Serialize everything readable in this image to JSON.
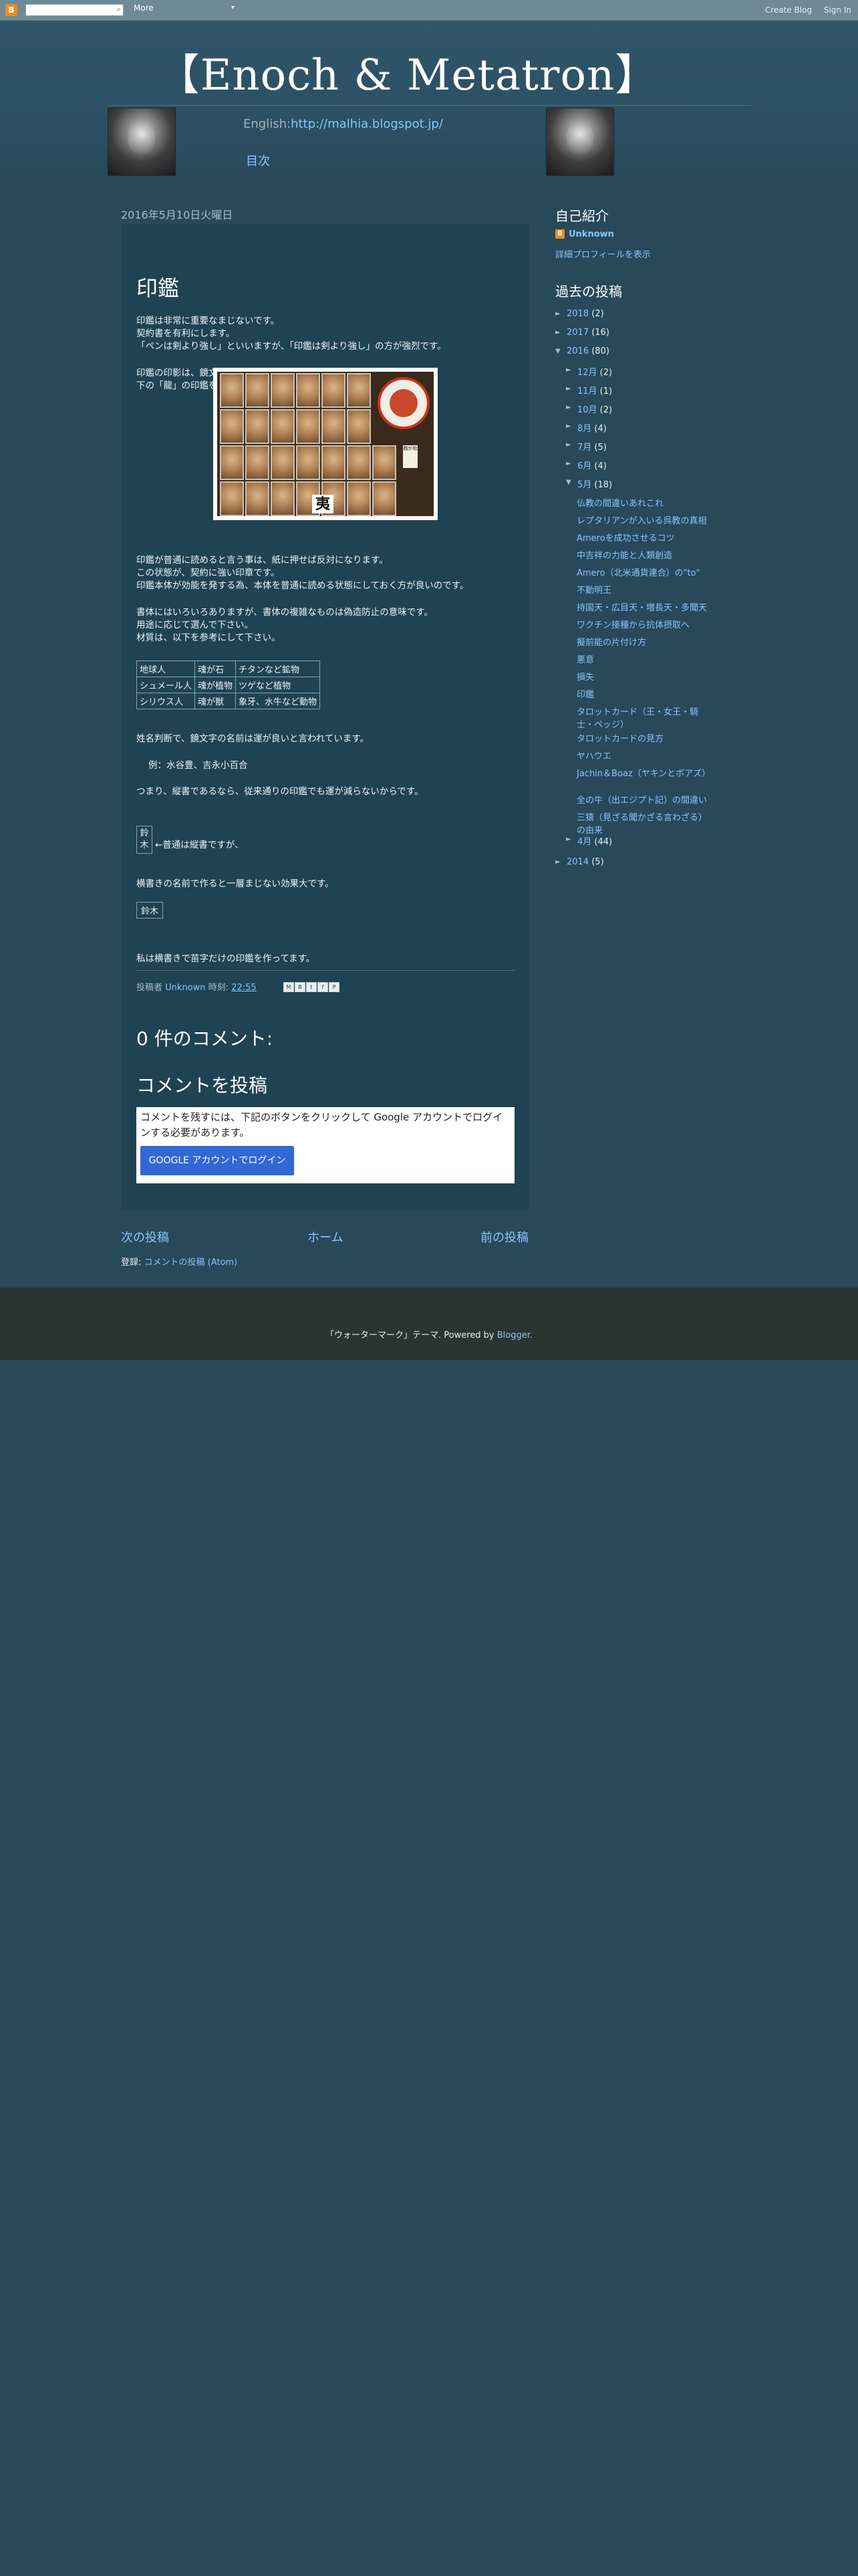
{
  "navbar": {
    "logo": "B",
    "more_label": "More",
    "create_blog": "Create Blog",
    "sign_in": "Sign In"
  },
  "header": {
    "title": "【Enoch & Metatron】",
    "english_label": "English:",
    "english_url": "http://malhia.blogspot.jp/",
    "toc_label": "目次"
  },
  "post": {
    "date": "2016年5月10日火曜日",
    "title": "印鑑",
    "paragraphs": [
      "印鑑は非常に重要なまじないです。",
      "契約書を有利にします。",
      "「ペンは剣より強し」といいますが、「印鑑は剣より強し」の方が強烈です。",
      "印鑑の印影は、鏡文字を使います。",
      "下の「龍」の印鑑を見て下さい。",
      "印鑑が普通に読めると言う事は、紙に押せば反対になります。",
      "この状態が、契約に強い印章です。",
      "印鑑本体が効能を発する為、本体を普通に読める状態にしておく方が良いのです。",
      "書体にはいろいろありますが、書体の複雑なものは偽造防止の意味です。",
      "用途に応じて選んで下さい。",
      "材質は、以下を参考にして下さい。",
      "姓名判断で、鏡文字の名前は運が良いと言われています。",
      "例：水谷豊、吉永小百合",
      "つまり、縦書であるなら、従来通りの印鑑でも運が減らないからです。",
      "←普通は縦書ですが、",
      "横書きの名前で作ると一層まじない効果大です。",
      "私は横書きで苗字だけの印鑑を作ってます。"
    ],
    "image": {
      "char": "夷",
      "tag": "鶴が和"
    },
    "materials": [
      [
        "地球人",
        "魂が石",
        "チタンなど鉱物"
      ],
      [
        "シュメール人",
        "魂が植物",
        "ツゲなど植物"
      ],
      [
        "シリウス人",
        "魂が獣",
        "象牙、水牛など動物"
      ]
    ],
    "suzuki_vertical": [
      "鈴",
      "木"
    ],
    "suzuki_horizontal": "鈴木",
    "footer": {
      "posted_by": "投稿者",
      "author": "Unknown",
      "time_label": "時刻:",
      "time": "22:55"
    },
    "comments_heading": "0 件のコメント:",
    "post_comment_heading": "コメントを投稿",
    "comment_notice": "コメントを残すには、下記のボタンをクリックして Google アカウントでログインする必要があります。",
    "login_button": "GOOGLE アカウントでログイン"
  },
  "pager": {
    "newer": "次の投稿",
    "home": "ホーム",
    "older": "前の投稿"
  },
  "subscribe": {
    "label": "登録:",
    "link": "コメントの投稿 (Atom)"
  },
  "sidebar": {
    "profile_heading": "自己紹介",
    "profile_name": "Unknown",
    "profile_link": "詳細プロフィールを表示",
    "archive_heading": "過去の投稿",
    "years": [
      {
        "year": "2018",
        "count": "(2)",
        "arrow": "►"
      },
      {
        "year": "2017",
        "count": "(16)",
        "arrow": "►"
      },
      {
        "year": "2016",
        "count": "(80)",
        "arrow": "▼"
      }
    ],
    "months": [
      {
        "month": "12月",
        "count": "(2)",
        "arrow": "►"
      },
      {
        "month": "11月",
        "count": "(1)",
        "arrow": "►"
      },
      {
        "month": "10月",
        "count": "(2)",
        "arrow": "►"
      },
      {
        "month": "8月",
        "count": "(4)",
        "arrow": "►"
      },
      {
        "month": "7月",
        "count": "(5)",
        "arrow": "►"
      },
      {
        "month": "6月",
        "count": "(4)",
        "arrow": "►"
      },
      {
        "month": "5月",
        "count": "(18)",
        "arrow": "▼"
      }
    ],
    "posts": [
      "仏教の間違いあれこれ",
      "レプタリアンが入いる呉教の真相",
      "Ameroを成功させるコツ",
      "中吉祥の力能と人類創造",
      "Amero（北米通貨連合）の\"to\"",
      "不動明王",
      "持国天・広目天・増長天・多聞天",
      "ワクチン接種から抗体摂取へ",
      "擬前能の片付け方",
      "悪意",
      "損失",
      "印鑑",
      "タロットカード（王・女王・騎士・ペッジ）",
      "タロットカードの見方",
      "ヤハウエ",
      "Jachin＆Boaz（ヤキンとボアズ）",
      "全の牛（出エジプト記）の間違い",
      "三猿（見ざる聞かざる言わざる）の由来"
    ],
    "april": {
      "month": "4月",
      "count": "(44)",
      "arrow": "►"
    },
    "year2014": {
      "year": "2014",
      "count": "(5)",
      "arrow": "►"
    }
  },
  "footer": {
    "text": "「ウォーターマーク」テーマ. Powered by",
    "link": "Blogger."
  },
  "colors": {
    "background": "#27495a",
    "post_bg": "#1f4353",
    "link": "#8bc4ff",
    "footer_bg": "#2a3430"
  }
}
